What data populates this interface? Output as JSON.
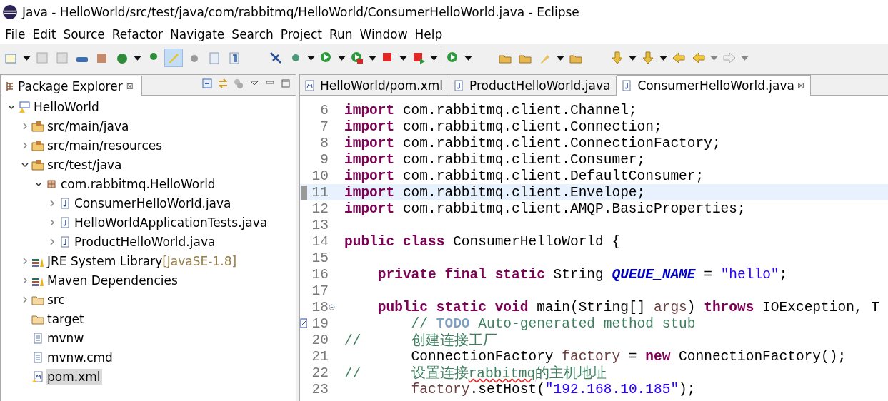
{
  "window": {
    "title": "Java - HelloWorld/src/test/java/com/rabbitmq/HelloWorld/ConsumerHelloWorld.java - Eclipse"
  },
  "menu": [
    "File",
    "Edit",
    "Source",
    "Refactor",
    "Navigate",
    "Search",
    "Project",
    "Run",
    "Window",
    "Help"
  ],
  "package_explorer": {
    "title": "Package Explorer",
    "close": "⊠",
    "tree": [
      {
        "label": "HelloWorld",
        "kind": "project",
        "expanded": true,
        "selected": false,
        "children": [
          {
            "label": "src/main/java",
            "kind": "source-folder",
            "expanded": false,
            "selected": false
          },
          {
            "label": "src/main/resources",
            "kind": "source-folder",
            "expanded": false,
            "selected": false
          },
          {
            "label": "src/test/java",
            "kind": "source-folder",
            "expanded": true,
            "selected": false,
            "children": [
              {
                "label": "com.rabbitmq.HelloWorld",
                "kind": "package",
                "expanded": true,
                "selected": false,
                "children": [
                  {
                    "label": "ConsumerHelloWorld.java",
                    "kind": "java-file",
                    "expanded": false,
                    "selected": false
                  },
                  {
                    "label": "HelloWorldApplicationTests.java",
                    "kind": "java-file",
                    "expanded": false,
                    "selected": false
                  },
                  {
                    "label": "ProductHelloWorld.java",
                    "kind": "java-file",
                    "expanded": false,
                    "selected": false
                  }
                ]
              }
            ]
          },
          {
            "label": "JRE System Library",
            "decoration": "[JavaSE-1.8]",
            "kind": "library",
            "expanded": false,
            "selected": false
          },
          {
            "label": "Maven Dependencies",
            "kind": "library",
            "expanded": false,
            "selected": false
          },
          {
            "label": "src",
            "kind": "folder",
            "expanded": false,
            "selected": false
          },
          {
            "label": "target",
            "kind": "folder",
            "selected": false
          },
          {
            "label": "mvnw",
            "kind": "file",
            "selected": false
          },
          {
            "label": "mvnw.cmd",
            "kind": "file",
            "selected": false
          },
          {
            "label": "pom.xml",
            "kind": "xml-file",
            "selected": true
          }
        ]
      }
    ]
  },
  "editor": {
    "tabs": [
      {
        "label": "HelloWorld/pom.xml",
        "kind": "xml-file",
        "selected": false
      },
      {
        "label": "ProductHelloWorld.java",
        "kind": "java-file",
        "selected": false
      },
      {
        "label": "ConsumerHelloWorld.java",
        "kind": "java-file",
        "selected": true,
        "close": "⊠"
      }
    ],
    "lines": [
      {
        "number": "6",
        "kind": "plain",
        "current": false,
        "tokens": [
          {
            "kind": "keyword",
            "text": "import"
          },
          {
            "kind": "plain",
            "text": " com.rabbitmq.client.Channel;"
          }
        ]
      },
      {
        "number": "7",
        "kind": "plain",
        "current": false,
        "tokens": [
          {
            "kind": "keyword",
            "text": "import"
          },
          {
            "kind": "plain",
            "text": " com.rabbitmq.client.Connection;"
          }
        ]
      },
      {
        "number": "8",
        "kind": "plain",
        "current": false,
        "tokens": [
          {
            "kind": "keyword",
            "text": "import"
          },
          {
            "kind": "plain",
            "text": " com.rabbitmq.client.ConnectionFactory;"
          }
        ]
      },
      {
        "number": "9",
        "kind": "plain",
        "current": false,
        "tokens": [
          {
            "kind": "keyword",
            "text": "import"
          },
          {
            "kind": "plain",
            "text": " com.rabbitmq.client.Consumer;"
          }
        ]
      },
      {
        "number": "10",
        "kind": "plain",
        "current": false,
        "tokens": [
          {
            "kind": "keyword",
            "text": "import"
          },
          {
            "kind": "plain",
            "text": " com.rabbitmq.client.DefaultConsumer;"
          }
        ]
      },
      {
        "number": "11",
        "kind": "changed",
        "current": true,
        "tokens": [
          {
            "kind": "keyword",
            "text": "import"
          },
          {
            "kind": "plain",
            "text": " com.rabbitmq.client.Envelope;"
          }
        ]
      },
      {
        "number": "12",
        "kind": "plain",
        "current": false,
        "tokens": [
          {
            "kind": "keyword",
            "text": "import"
          },
          {
            "kind": "plain",
            "text": " com.rabbitmq.client.AMQP.BasicProperties;"
          }
        ]
      },
      {
        "number": "13",
        "kind": "plain",
        "current": false
      },
      {
        "number": "14",
        "kind": "plain",
        "current": false,
        "tokens": [
          {
            "kind": "keyword",
            "text": "public class"
          },
          {
            "kind": "plain",
            "text": " ConsumerHelloWorld {"
          }
        ]
      },
      {
        "number": "15",
        "kind": "plain",
        "current": false
      },
      {
        "number": "16",
        "kind": "plain",
        "current": false,
        "tokens": [
          {
            "kind": "keyword",
            "text": "    private final static"
          },
          {
            "kind": "plain",
            "text": " String "
          },
          {
            "kind": "field",
            "text": "QUEUE_NAME"
          },
          {
            "kind": "plain",
            "text": " = "
          },
          {
            "kind": "string",
            "text": "\"hello\""
          },
          {
            "kind": "plain",
            "text": ";"
          }
        ]
      },
      {
        "number": "17",
        "kind": "plain",
        "current": false
      },
      {
        "number": "18",
        "kind": "foldable",
        "current": false,
        "tokens": [
          {
            "kind": "keyword",
            "text": "    public static void"
          },
          {
            "kind": "plain",
            "text": " main(String[] "
          },
          {
            "kind": "variable",
            "text": "args"
          },
          {
            "kind": "plain",
            "text": ") "
          },
          {
            "kind": "keyword",
            "text": "throws"
          },
          {
            "kind": "plain",
            "text": " IOException, T"
          }
        ]
      },
      {
        "number": "19",
        "kind": "task",
        "current": false,
        "tokens": [
          {
            "kind": "comment",
            "text": "        // "
          },
          {
            "kind": "todo",
            "text": "TODO"
          },
          {
            "kind": "comment",
            "text": " Auto-generated method stub"
          }
        ]
      },
      {
        "number": "20",
        "kind": "plain",
        "current": false,
        "tokens": [
          {
            "kind": "comment",
            "text": "//      创建连接工厂"
          }
        ]
      },
      {
        "number": "21",
        "kind": "plain",
        "current": false,
        "tokens": [
          {
            "kind": "plain",
            "text": "        ConnectionFactory "
          },
          {
            "kind": "variable",
            "text": "factory"
          },
          {
            "kind": "plain",
            "text": " = "
          },
          {
            "kind": "keyword",
            "text": "new"
          },
          {
            "kind": "plain",
            "text": " ConnectionFactory();"
          }
        ]
      },
      {
        "number": "22",
        "kind": "plain",
        "current": false,
        "tokens": [
          {
            "kind": "comment",
            "text": "//      设置连接"
          },
          {
            "kind": "misspelled",
            "text": "rabbitmq"
          },
          {
            "kind": "comment",
            "text": "的主机地址"
          }
        ]
      },
      {
        "number": "23",
        "kind": "plain",
        "current": false,
        "tokens": [
          {
            "kind": "variable",
            "text": "        factory"
          },
          {
            "kind": "plain",
            "text": ".setHost("
          },
          {
            "kind": "string",
            "text": "\"192.168.10.185\""
          },
          {
            "kind": "plain",
            "text": ");"
          }
        ]
      }
    ]
  }
}
